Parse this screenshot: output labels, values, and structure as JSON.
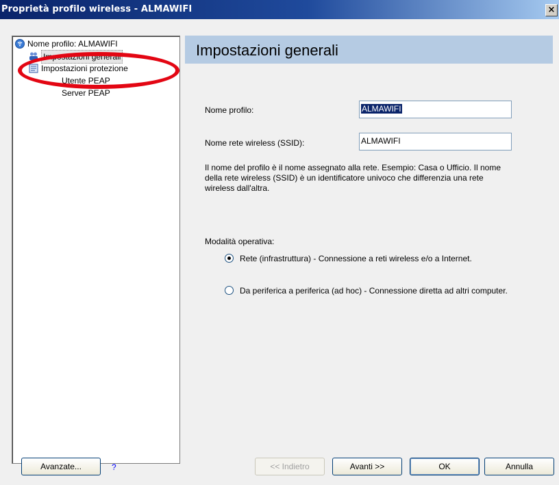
{
  "window": {
    "title": "Proprietà profilo wireless - ALMAWIFI",
    "close_label": "×"
  },
  "tree": {
    "items": [
      {
        "label": "Nome profilo: ALMAWIFI",
        "icon": "wireless-signal-icon"
      },
      {
        "label": "Impostazioni generali",
        "icon": "users-icon"
      },
      {
        "label": "Impostazioni protezione",
        "icon": "security-document-icon"
      },
      {
        "label": "Utente PEAP"
      },
      {
        "label": "Server PEAP"
      }
    ]
  },
  "header": {
    "title": "Impostazioni generali"
  },
  "form": {
    "profile_name_label": "Nome profilo:",
    "profile_name_value": "ALMAWIFI",
    "ssid_label": "Nome rete wireless (SSID):",
    "ssid_value": "ALMAWIFI",
    "description": "Il nome del profilo è il nome assegnato alla rete. Esempio: Casa o Ufficio. Il nome della rete wireless (SSID) è un identificatore univoco che differenzia una rete wireless dall'altra.",
    "mode_label": "Modalità operativa:",
    "modes": [
      {
        "label": "Rete (infrastruttura) - Connessione a reti wireless e/o a Internet.",
        "checked": true
      },
      {
        "label": "Da periferica a periferica (ad hoc) - Connessione diretta ad altri computer.",
        "checked": false
      }
    ]
  },
  "buttons": {
    "advanced": "Avanzate...",
    "help": "?",
    "back": "<< Indietro",
    "next": "Avanti >>",
    "ok": "OK",
    "cancel": "Annulla"
  },
  "colors": {
    "highlight_ellipse": "#e30613",
    "header_band": "#b5cbe3",
    "title_bar": "#0a246a"
  }
}
